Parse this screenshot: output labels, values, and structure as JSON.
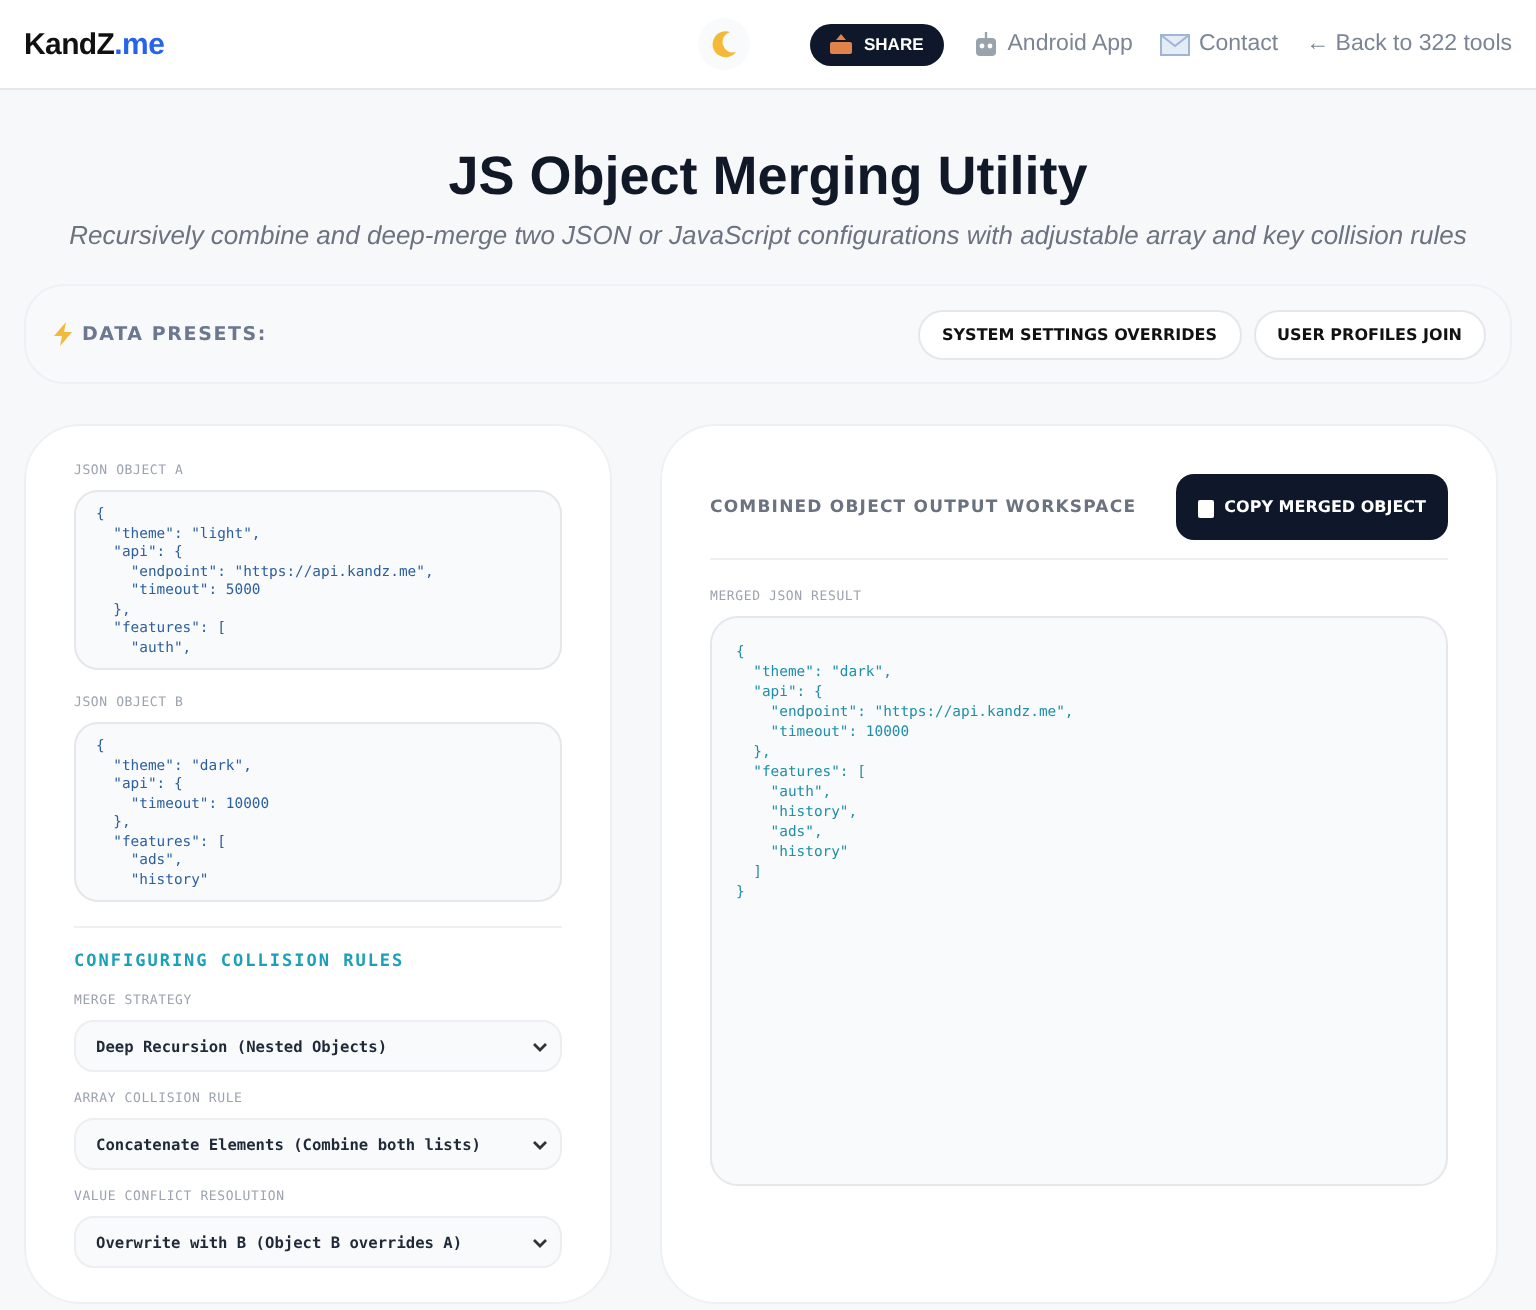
{
  "header": {
    "logo_main": "KandZ",
    "logo_accent": ".me",
    "share_label": "SHARE",
    "links": [
      {
        "kind": "android",
        "label": "Android App"
      },
      {
        "kind": "mail",
        "label": "Contact"
      },
      {
        "kind": "back",
        "label": "← Back to 322 tools"
      }
    ]
  },
  "hero": {
    "title": "JS Object Merging Utility",
    "subtitle": "Recursively combine and deep-merge two JSON or JavaScript configurations with adjustable array and key collision rules"
  },
  "presets": {
    "label": "DATA PRESETS:",
    "buttons": [
      "SYSTEM SETTINGS OVERRIDES",
      "USER PROFILES JOIN"
    ]
  },
  "inputs": [
    {
      "label": "JSON OBJECT A",
      "value": "{\n  \"theme\": \"light\",\n  \"api\": {\n    \"endpoint\": \"https://api.kandz.me\",\n    \"timeout\": 5000\n  },\n  \"features\": [\n    \"auth\","
    },
    {
      "label": "JSON OBJECT B",
      "value": "{\n  \"theme\": \"dark\",\n  \"api\": {\n    \"timeout\": 10000\n  },\n  \"features\": [\n    \"ads\",\n    \"history\""
    }
  ],
  "rules": {
    "title": "CONFIGURING COLLISION RULES",
    "selects": [
      {
        "label": "MERGE STRATEGY",
        "value": "Deep Recursion (Nested Objects)"
      },
      {
        "label": "ARRAY COLLISION RULE",
        "value": "Concatenate Elements (Combine both lists)"
      },
      {
        "label": "VALUE CONFLICT RESOLUTION",
        "value": "Overwrite with B (Object B overrides A)"
      }
    ]
  },
  "output": {
    "title": "COMBINED OBJECT OUTPUT WORKSPACE",
    "copy_label": "COPY MERGED OBJECT",
    "result_label": "MERGED JSON RESULT",
    "value": "{\n  \"theme\": \"dark\",\n  \"api\": {\n    \"endpoint\": \"https://api.kandz.me\",\n    \"timeout\": 10000\n  },\n  \"features\": [\n    \"auth\",\n    \"history\",\n    \"ads\",\n    \"history\"\n  ]\n}"
  }
}
